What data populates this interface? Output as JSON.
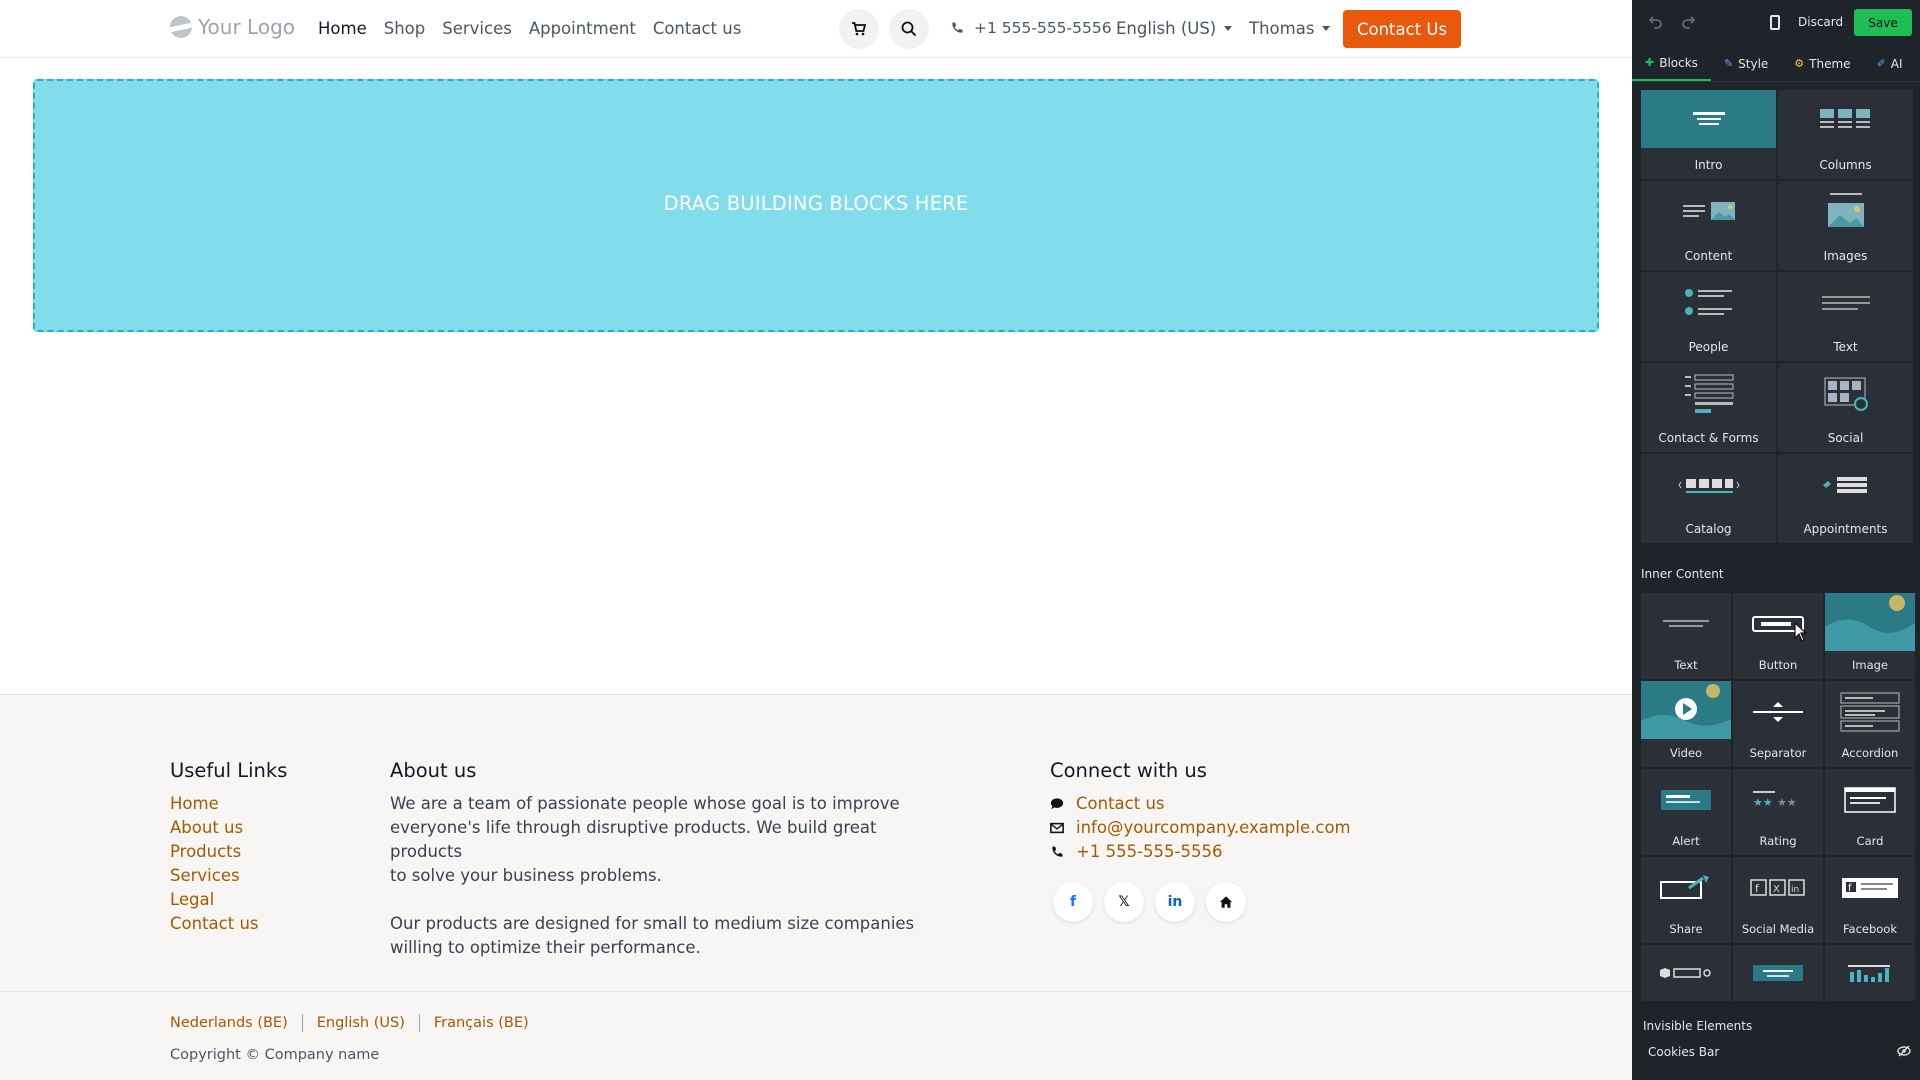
{
  "header": {
    "logo_text": "Your Logo",
    "menu": [
      {
        "label": "Home",
        "active": true
      },
      {
        "label": "Shop"
      },
      {
        "label": "Services"
      },
      {
        "label": "Appointment"
      },
      {
        "label": "Contact us"
      }
    ],
    "phone": "+1 555-555-5556",
    "language": "English (US)",
    "user": "Thomas",
    "cta": "Contact Us"
  },
  "dropzone": {
    "text": "DRAG BUILDING BLOCKS HERE"
  },
  "footer": {
    "useful_links": {
      "title": "Useful Links",
      "links": [
        "Home",
        "About us",
        "Products",
        "Services",
        "Legal",
        "Contact us"
      ]
    },
    "about": {
      "title": "About us",
      "p1_lines": [
        "We are a team of passionate people whose goal is to improve",
        "everyone's life through disruptive products. We build great products",
        "to solve your business problems."
      ],
      "p2_lines": [
        "Our products are designed for small to medium size companies",
        "willing to optimize their performance."
      ]
    },
    "connect": {
      "title": "Connect with us",
      "contact": "Contact us",
      "email": "info@yourcompany.example.com",
      "phone": "+1 555-555-5556",
      "social_icons": [
        "facebook-icon",
        "x-icon",
        "linkedin-icon",
        "home-icon"
      ]
    },
    "languages": [
      "Nederlands (BE)",
      "English (US)",
      "Français (BE)"
    ],
    "copyright": "Copyright © Company name"
  },
  "panel": {
    "discard": "Discard",
    "save": "Save",
    "tabs": [
      {
        "label": "Blocks",
        "icon": "plus-icon",
        "active": true
      },
      {
        "label": "Style",
        "icon": "brush-icon"
      },
      {
        "label": "Theme",
        "icon": "gear-icon"
      },
      {
        "label": "AI",
        "icon": "wand-icon"
      }
    ],
    "blocks": [
      "Intro",
      "Columns",
      "Content",
      "Images",
      "People",
      "Text",
      "Contact & Forms",
      "Social",
      "Catalog",
      "Appointments"
    ],
    "inner_title": "Inner Content",
    "inner": [
      "Text",
      "Button",
      "Image",
      "Video",
      "Separator",
      "Accordion",
      "Alert",
      "Rating",
      "Card",
      "Share",
      "Social Media",
      "Facebook"
    ],
    "invisible_title": "Invisible Elements",
    "invisible_items": [
      "Cookies Bar"
    ]
  },
  "colors": {
    "accent": "#e8590c",
    "link": "#a35a00",
    "dropzone_bg": "#81dceb",
    "panel_bg": "#1f232a",
    "save_green": "#1fbe55"
  }
}
